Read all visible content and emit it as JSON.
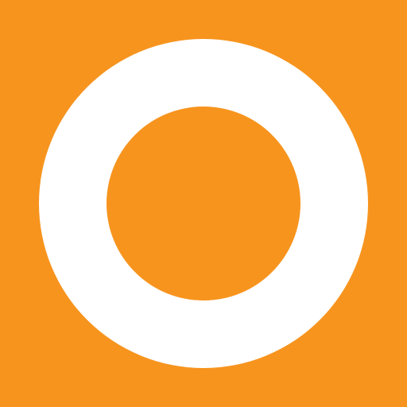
{
  "icon": {
    "name": "ring-icon"
  },
  "colors": {
    "background": "#F7941E",
    "ring": "#FFFFFF",
    "center": "#F7941E"
  }
}
